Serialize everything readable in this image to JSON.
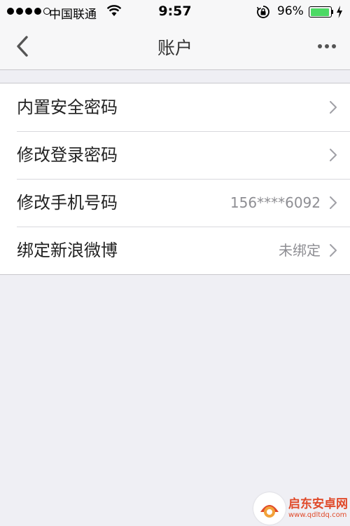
{
  "status_bar": {
    "carrier": "中国联通",
    "time": "9:57",
    "battery_percent": "96%",
    "battery_level": 0.96,
    "signal_bars_filled": 4,
    "signal_bars_total": 5
  },
  "nav": {
    "title": "账户"
  },
  "rows": [
    {
      "label": "内置安全密码",
      "value": ""
    },
    {
      "label": "修改登录密码",
      "value": ""
    },
    {
      "label": "修改手机号码",
      "value": "156****6092"
    },
    {
      "label": "绑定新浪微博",
      "value": "未绑定"
    }
  ],
  "watermark": {
    "title": "启东安卓网",
    "url": "www.qdltdq.com"
  },
  "colors": {
    "battery": "#4cd964",
    "background": "#efeff4",
    "watermark": "#e04a2a"
  }
}
